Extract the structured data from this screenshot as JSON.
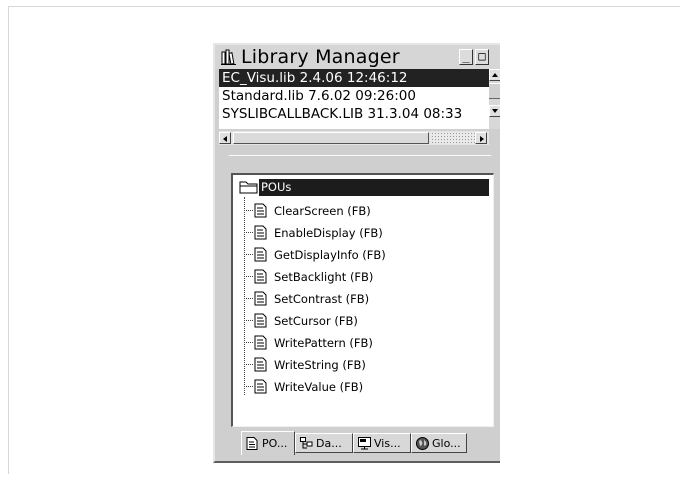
{
  "window": {
    "title": "Library Manager",
    "minimize_label": "_",
    "maximize_label": "□"
  },
  "libraries": [
    {
      "label": "EC_Visu.lib 2.4.06 12:46:12",
      "selected": true
    },
    {
      "label": "Standard.lib 7.6.02 09:26:00",
      "selected": false
    },
    {
      "label": "SYSLIBCALLBACK.LIB 31.3.04 08:33",
      "selected": false
    }
  ],
  "tree": {
    "root_label": "POUs",
    "items": [
      {
        "label": "ClearScreen (FB)",
        "icon": "document-icon"
      },
      {
        "label": "EnableDisplay (FB)",
        "icon": "document-icon"
      },
      {
        "label": "GetDisplayInfo (FB)",
        "icon": "document-icon"
      },
      {
        "label": "SetBacklight (FB)",
        "icon": "document-icon"
      },
      {
        "label": "SetContrast (FB)",
        "icon": "document-icon"
      },
      {
        "label": "SetCursor (FB)",
        "icon": "document-icon"
      },
      {
        "label": "WritePattern (FB)",
        "icon": "document-icon"
      },
      {
        "label": "WriteString (FB)",
        "icon": "document-icon"
      },
      {
        "label": "WriteValue (FB)",
        "icon": "document-icon"
      }
    ]
  },
  "tabs": [
    {
      "label": "PO...",
      "icon": "pou-icon",
      "active": true
    },
    {
      "label": "Da...",
      "icon": "datatypes-icon",
      "active": false
    },
    {
      "label": "Vis...",
      "icon": "visualization-icon",
      "active": false
    },
    {
      "label": "Glo...",
      "icon": "globe-icon",
      "active": false
    }
  ]
}
